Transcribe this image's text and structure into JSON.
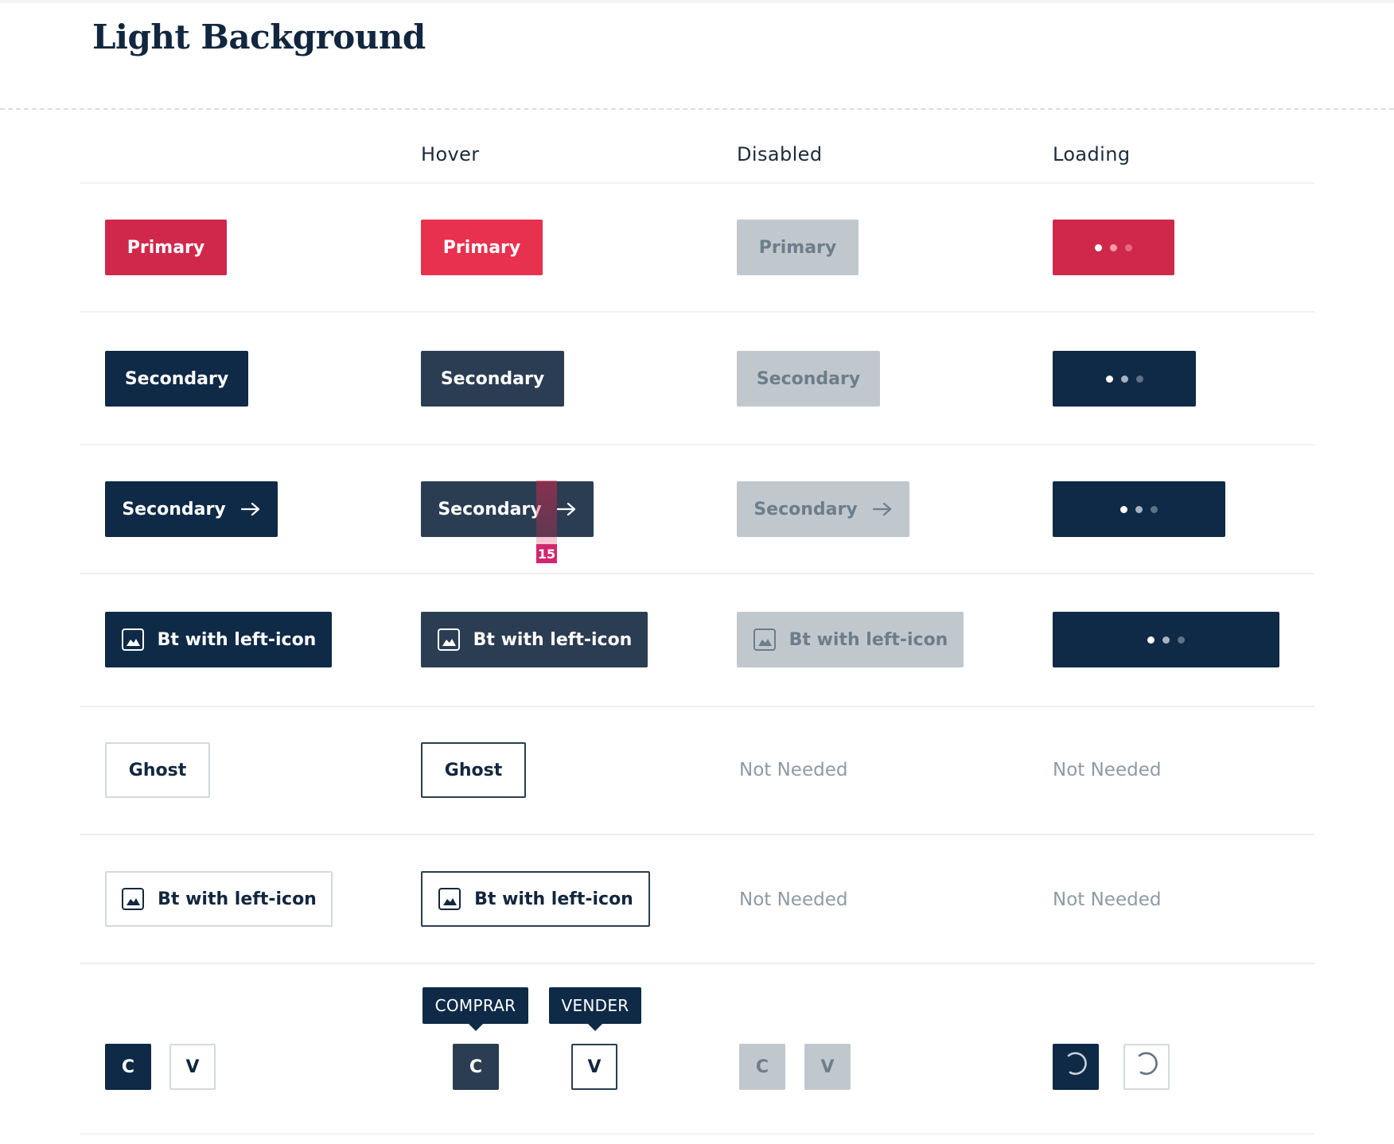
{
  "page": {
    "title": "Light Background"
  },
  "columns": [
    "Hover",
    "Disabled",
    "Loading"
  ],
  "rows": {
    "primary_label": "Primary",
    "secondary_label": "Secondary",
    "icon_label": "Bt with left-icon",
    "ghost_label": "Ghost",
    "not_needed": "Not Needed"
  },
  "square_buttons": {
    "buy_short": "C",
    "sell_short": "V",
    "buy_tooltip": "COMPRAR",
    "sell_tooltip": "VENDER"
  },
  "measure_badge": {
    "value": "15"
  },
  "colors": {
    "primary": "#d0284b",
    "primary_hover": "#e8304f",
    "secondary": "#0e2a47",
    "secondary_hover": "#2b3d52",
    "disabled_bg": "#c1c8cd",
    "muted_text": "#8e9aa6"
  }
}
